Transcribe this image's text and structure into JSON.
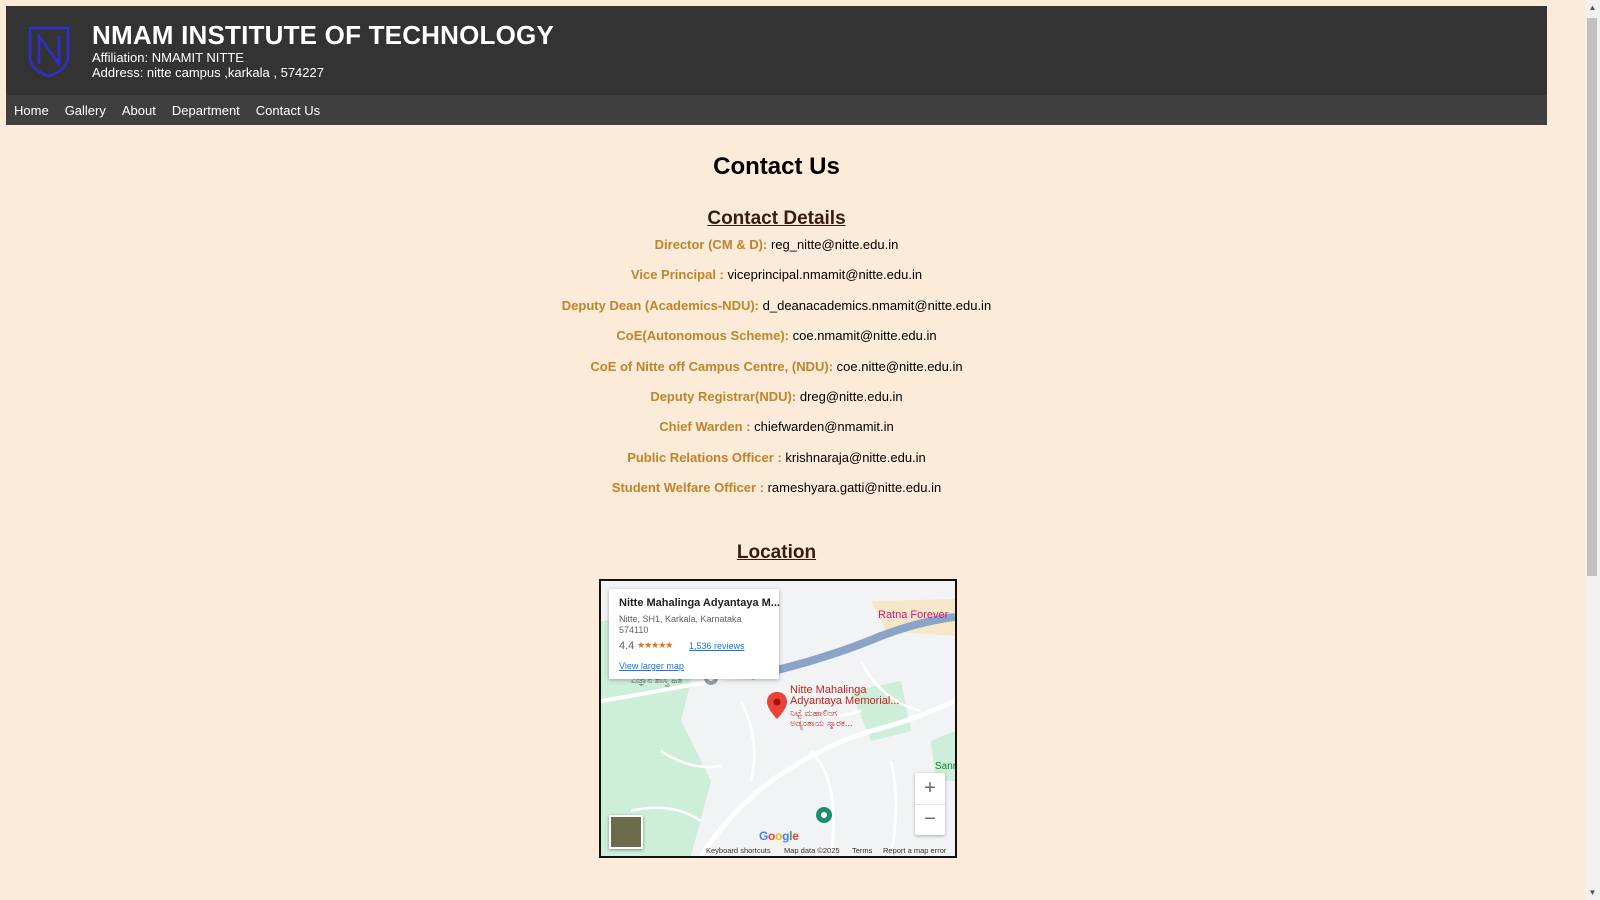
{
  "header": {
    "logo": "shield-n-logo",
    "title": "NMAM INSTITUTE OF TECHNOLOGY",
    "affiliation": "Affiliation: NMAMIT NITTE",
    "address": "Address: nitte campus ,karkala , 574227"
  },
  "nav": [
    "Home",
    "Gallery",
    "About",
    "Department",
    "Contact Us"
  ],
  "page_title": "Contact Us",
  "contact_section_title": "Contact Details",
  "contacts": [
    {
      "label": "Director (CM & D):",
      "value": "reg_nitte@nitte.edu.in"
    },
    {
      "label": "Vice Principal :",
      "value": "viceprincipal.nmamit@nitte.edu.in"
    },
    {
      "label": "Deputy Dean (Academics-NDU):",
      "value": "d_deanacademics.nmamit@nitte.edu.in"
    },
    {
      "label": "CoE(Autonomous Scheme):",
      "value": "coe.nmamit@nitte.edu.in"
    },
    {
      "label": "CoE of Nitte off Campus Centre, (NDU):",
      "value": "coe.nitte@nitte.edu.in"
    },
    {
      "label": "Deputy Registrar(NDU):",
      "value": "dreg@nitte.edu.in"
    },
    {
      "label": "Chief Warden :",
      "value": "chiefwarden@nmamit.in"
    },
    {
      "label": "Public Relations Officer :",
      "value": "krishnaraja@nitte.edu.in"
    },
    {
      "label": "Student Welfare Officer :",
      "value": "rameshyara.gatti@nitte.edu.in"
    }
  ],
  "location_section_title": "Location",
  "map": {
    "card": {
      "name": "Nitte Mahalinga Adyantaya M...",
      "address": "Nitte, SH1, Karkala, Karnataka 574110",
      "rating": "4.4",
      "stars": "★★★★★",
      "reviews": "1,536 reviews",
      "view_larger": "View larger map"
    },
    "label_ratna": "Ratna Forever",
    "label_place_1": "Nitte Mahalinga",
    "label_place_2": "Adyantaya Memorial...",
    "label_place_kn_1": "ನಿಟ್ಟೆ ಮಹಾಲಿಂಗ",
    "label_place_kn_2": "ಅಡ್ಯಂತಾಯ ಸ್ಮಾರಕ...",
    "label_left": "ವಿಜ್ಞಾನ ಶಾಸ್ತ್ರ ಹಿತ",
    "label_san": "Sanma",
    "zoom_in": "+",
    "zoom_out": "−",
    "google": "Google",
    "footer": {
      "shortcuts": "Keyboard shortcuts",
      "data": "Map data ©2025",
      "terms": "Terms",
      "report": "Report a map error"
    },
    "colors": {
      "road": "#8aa4c8",
      "park": "#c8ecd4",
      "pin": "#ea4335"
    }
  }
}
